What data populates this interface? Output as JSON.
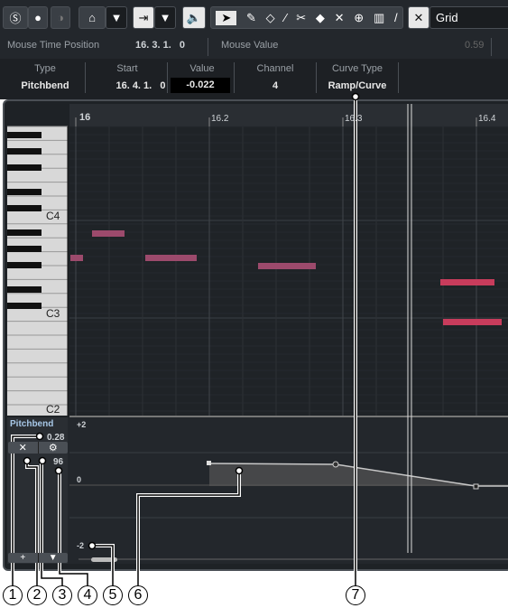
{
  "toolbar": {
    "snap_label": "Grid",
    "tools": [
      "solo-icon",
      "record-icon",
      "feedback-icon",
      "autoscroll-icon",
      "dropdown-icon",
      "step-input-icon",
      "dropdown-icon",
      "acoustic-feedback-icon",
      "select-icon",
      "draw-icon",
      "erase-icon",
      "trim-icon",
      "split-icon",
      "glue-icon",
      "mute-icon",
      "zoom-icon",
      "line-icon",
      "time-warp-icon",
      "snap-icon"
    ]
  },
  "infobar": {
    "mouse_time_label": "Mouse Time Position",
    "mouse_time_value": "16. 3. 1.   0",
    "mouse_value_label": "Mouse Value",
    "mouse_value": "0.59"
  },
  "event_info": {
    "columns": [
      {
        "label": "Type",
        "value": "Pitchbend"
      },
      {
        "label": "Start",
        "value": "16. 4. 1.   0"
      },
      {
        "label": "Value",
        "value": "-0.022"
      },
      {
        "label": "Channel",
        "value": "4"
      },
      {
        "label": "Curve Type",
        "value": "Ramp/Curve"
      }
    ]
  },
  "ruler": {
    "labels": [
      "16",
      "16.2",
      "16.3",
      "16.4"
    ]
  },
  "keyboard": {
    "labels": [
      "C4",
      "C3",
      "C2"
    ]
  },
  "controller": {
    "name": "Pitchbend",
    "current_value": "0.28",
    "range": "96",
    "scale": [
      "+2",
      "0",
      "-2"
    ]
  },
  "callouts": [
    "1",
    "2",
    "3",
    "4",
    "5",
    "6",
    "7"
  ],
  "colors": {
    "note": "#9c4a6c",
    "note_selected": "#c83c5c",
    "curve": "#c8c8c8"
  }
}
